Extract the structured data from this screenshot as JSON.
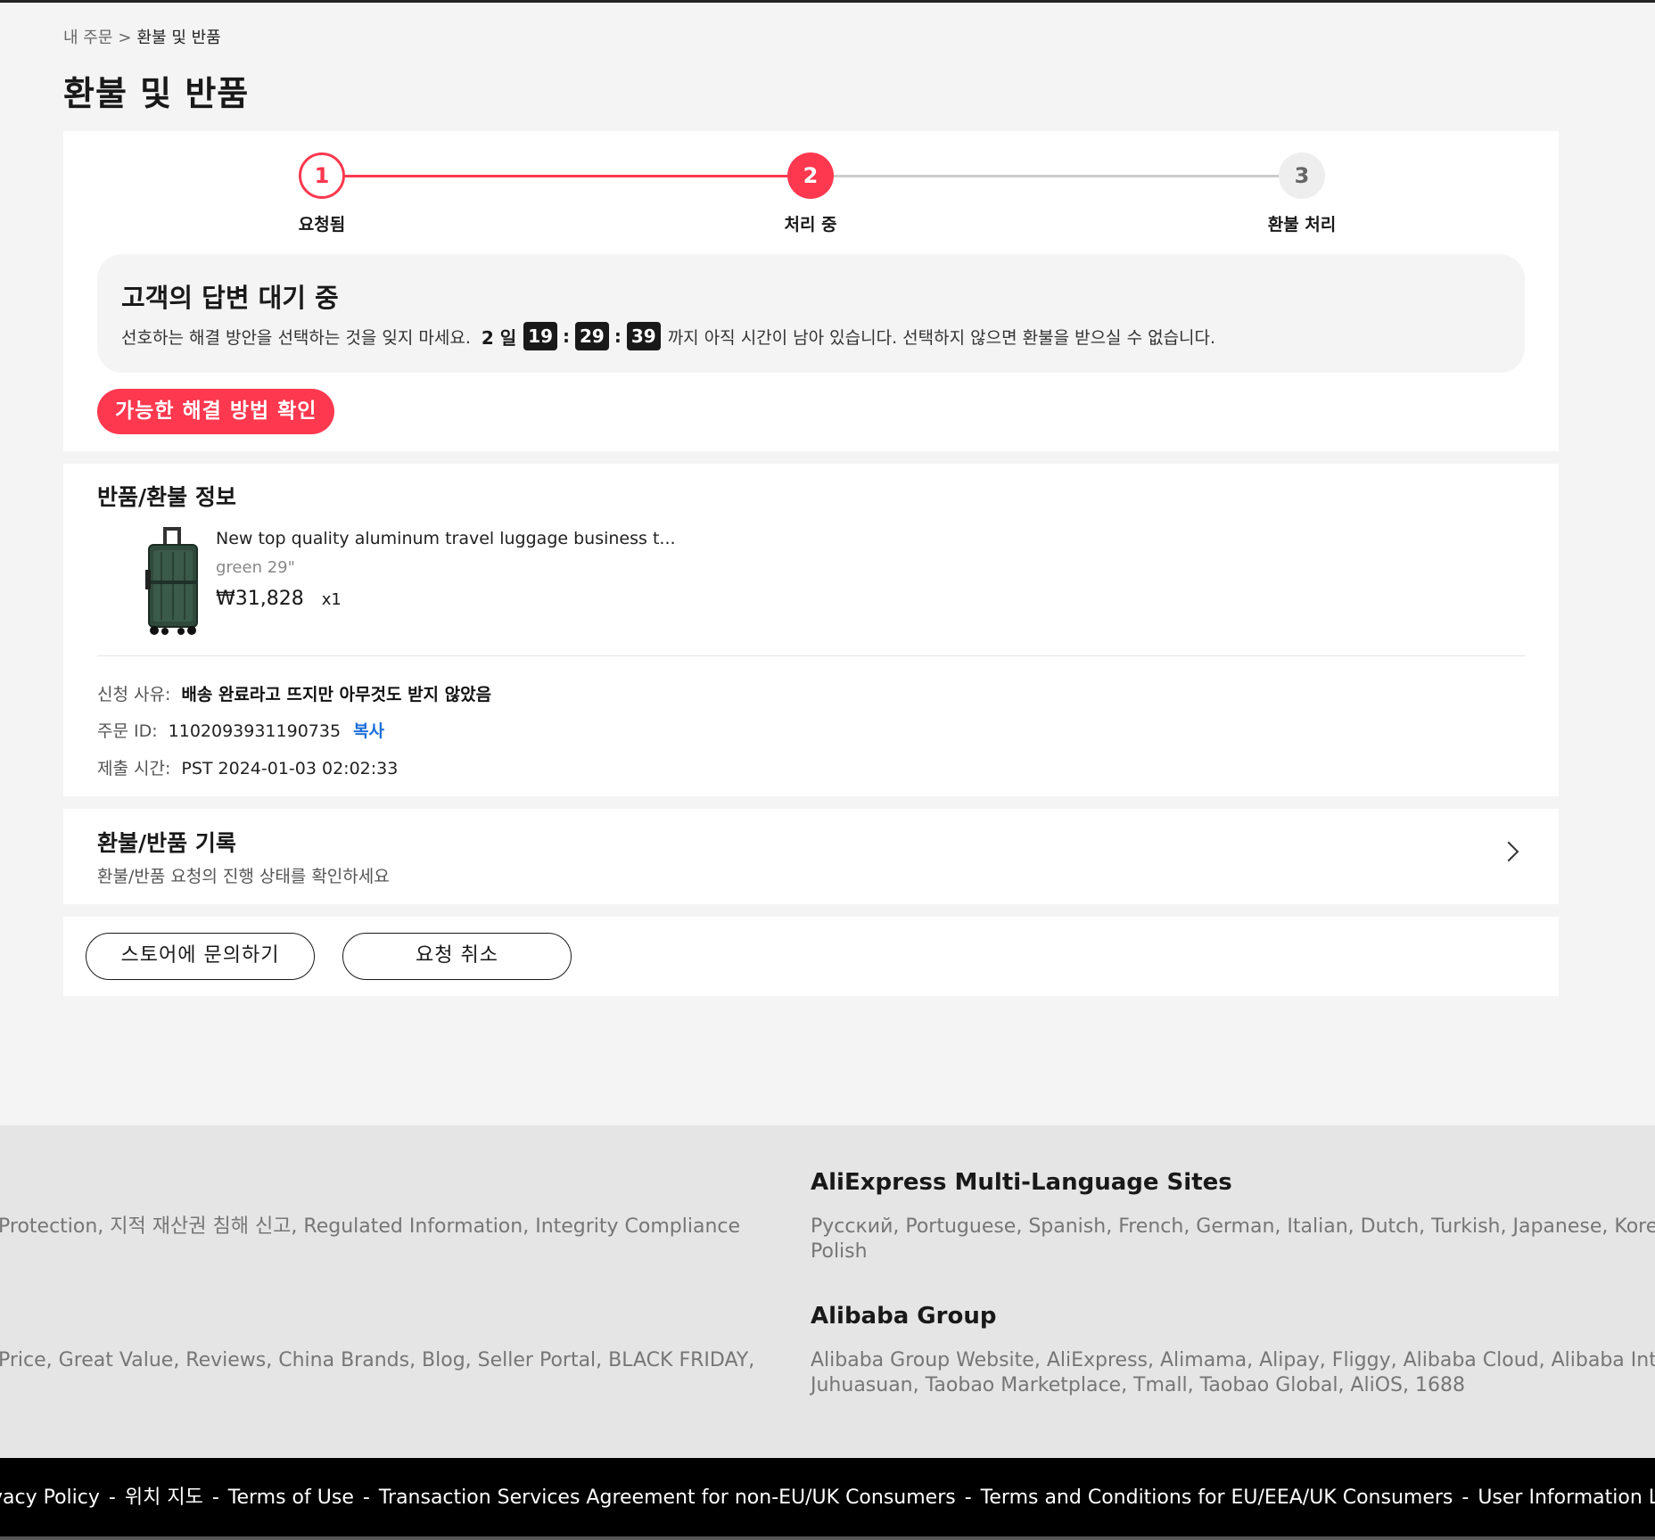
{
  "breadcrumb": {
    "parent": "내 주문",
    "separator": ">",
    "current": "환불 및 반품"
  },
  "page_title": "환불 및 반품",
  "progress": {
    "steps": [
      {
        "number": "1",
        "label": "요청됨"
      },
      {
        "number": "2",
        "label": "처리 중"
      },
      {
        "number": "3",
        "label": "환불 처리"
      }
    ],
    "current_step": 2,
    "accent_color": "#fd384f"
  },
  "waiting": {
    "title": "고객의 답변 대기 중",
    "before": "선호하는 해결 방안을 선택하는 것을 잊지 마세요.",
    "days": "2 일",
    "hours": "19",
    "minutes": "29",
    "seconds": "39",
    "after": "까지 아직 시간이 남아 있습니다. 선택하지 않으면 환불을 받으실 수 없습니다.",
    "button": "가능한 해결 방법 확인"
  },
  "info": {
    "title": "반품/환불 정보",
    "product": {
      "icon": "luggage-image",
      "title": "New top quality aluminum travel luggage business t...",
      "variant": "green 29\"",
      "price": "₩31,828",
      "qty": "x1"
    },
    "reason_label": "신청 사유:",
    "reason": "배송 완료라고 뜨지만 아무것도 받지 않았음",
    "order_label": "주문 ID:",
    "order_id": "1102093931190735",
    "copy": "복사",
    "submitted_label": "제출 시간:",
    "submitted": "PST 2024-01-03 02:02:33"
  },
  "record": {
    "title": "환불/반품 기록",
    "subtitle": "환불/반품 요청의 진행 상태를 확인하세요"
  },
  "actions": {
    "contact": "스토어에 문의하기",
    "cancel": "요청 취소"
  },
  "footer": {
    "left1": "Protection, 지적 재산권 침해 신고, Regulated Information, Integrity Compliance",
    "left2": " Price, Great Value, Reviews, China Brands, Blog, Seller Portal, BLACK FRIDAY,",
    "multi_title": "AliExpress Multi-Language Sites",
    "multi_line1": "Русский, Portuguese, Spanish, French, German, Italian, Dutch, Turkish, Japanese, Korean, Th",
    "multi_line2": "Polish",
    "group_title": "Alibaba Group",
    "group_line1": "Alibaba Group Website, AliExpress, Alimama, Alipay, Fliggy, Alibaba Cloud, Alibaba Internatio",
    "group_line2": "Juhuasuan, Taobao Marketplace, Tmall, Taobao Global, AliOS, 1688",
    "bottom_links": [
      "vacy Policy",
      "위치 지도",
      "Terms of Use",
      "Transaction Services Agreement for non-EU/UK Consumers",
      "Terms and Conditions for EU/EEA/UK Consumers",
      "User Information Legal E"
    ]
  }
}
